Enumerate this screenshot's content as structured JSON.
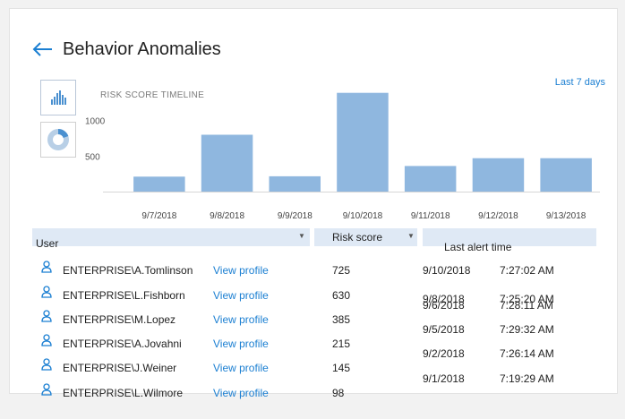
{
  "header": {
    "title": "Behavior Anomalies"
  },
  "chart_panel": {
    "label": "RISK SCORE TIMELINE",
    "range_link": "Last 7 days"
  },
  "chart_data": {
    "type": "bar",
    "title": "RISK SCORE TIMELINE",
    "categories": [
      "9/7/2018",
      "9/8/2018",
      "9/9/2018",
      "9/10/2018",
      "9/11/2018",
      "9/12/2018",
      "9/13/2018"
    ],
    "values": [
      210,
      800,
      215,
      1390,
      360,
      470,
      470
    ],
    "yticks": [
      500,
      1000
    ],
    "ylim": [
      0,
      1500
    ],
    "bar_color": "#8fb7df",
    "grid": false
  },
  "table": {
    "columns": [
      "User",
      "Risk score",
      "Last alert time"
    ],
    "rows": [
      {
        "user": "ENTERPRISE\\A.Tomlinson",
        "link": "View profile",
        "score": "725",
        "date": "9/10/2018",
        "time": "7:27:02 AM"
      },
      {
        "user": "ENTERPRISE\\L.Fishborn",
        "link": "View profile",
        "score": "630",
        "date": "9/8/2018",
        "time": "7:25:20 AM"
      },
      {
        "user": "ENTERPRISE\\M.Lopez",
        "link": "View profile",
        "score": "385",
        "date": "9/6/2018",
        "time": "7:28:11 AM"
      },
      {
        "user": "ENTERPRISE\\A.Jovahni",
        "link": "View profile",
        "score": "215",
        "date": "9/5/2018",
        "time": "7:29:32 AM"
      },
      {
        "user": "ENTERPRISE\\J.Weiner",
        "link": "View profile",
        "score": "145",
        "date": "9/2/2018",
        "time": "7:26:14 AM"
      },
      {
        "user": "ENTERPRISE\\L.Wilmore",
        "link": "View profile",
        "score": "98",
        "date": "9/1/2018",
        "time": "7:19:29 AM"
      }
    ]
  },
  "icons": {
    "back": "back-arrow-icon",
    "bar_view": "bar-chart-icon",
    "donut_view": "donut-chart-icon",
    "user": "user-icon"
  },
  "colors": {
    "accent": "#1b7fd2",
    "bar": "#8fb7df",
    "header_bg": "#dfe9f5"
  }
}
